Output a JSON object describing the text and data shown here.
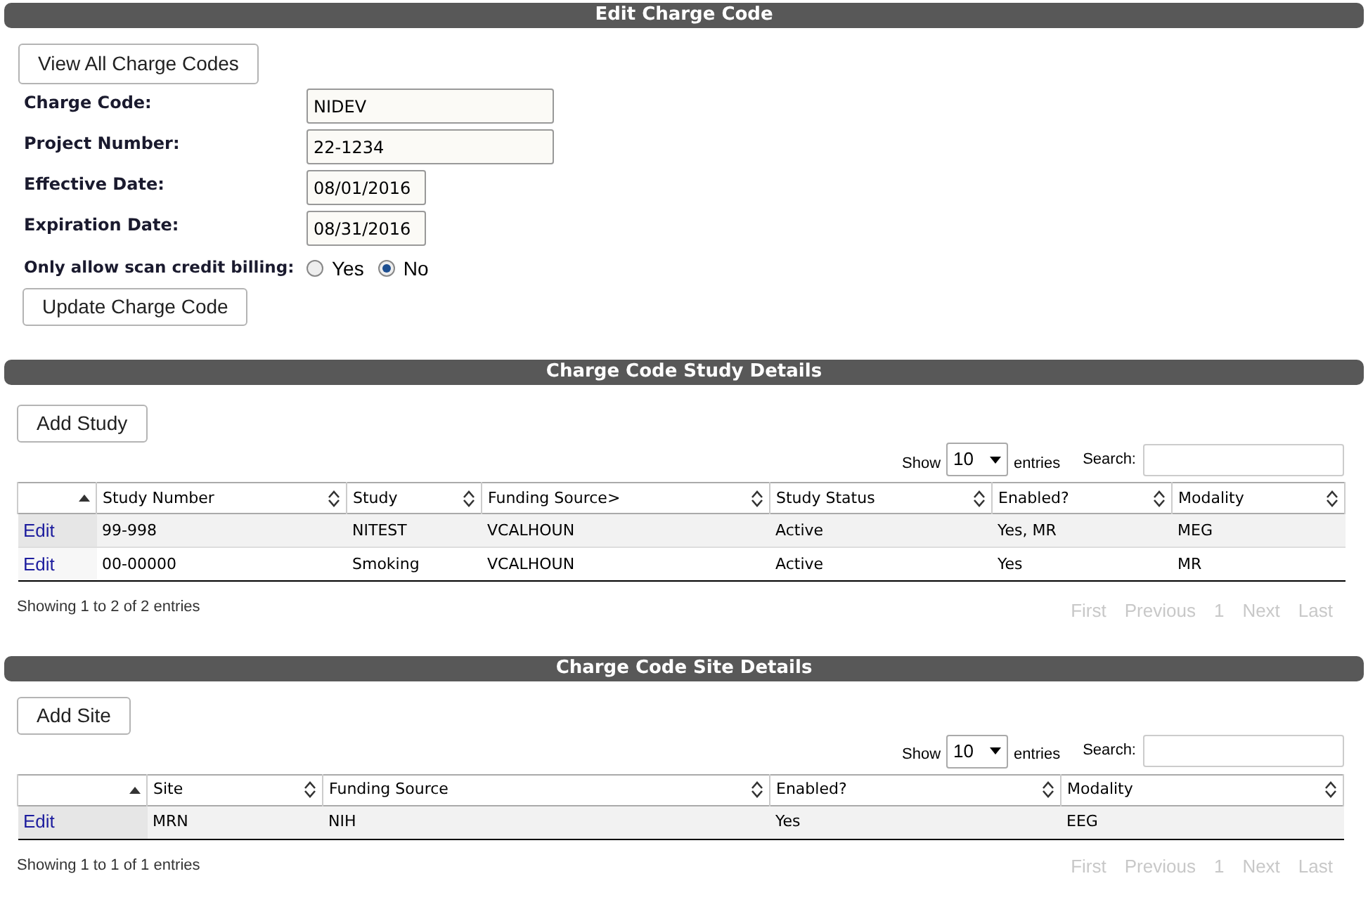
{
  "edit_section": {
    "title": "Edit Charge Code",
    "view_all_button": "View All Charge Codes",
    "fields": [
      {
        "label": "Charge Code:",
        "value": "NIDEV",
        "kind": "wide"
      },
      {
        "label": "Project Number:",
        "value": "22-1234",
        "kind": "wide"
      },
      {
        "label": "Effective Date:",
        "value": "08/01/2016",
        "kind": "date"
      },
      {
        "label": "Expiration Date:",
        "value": "08/31/2016",
        "kind": "date"
      }
    ],
    "billing": {
      "label": "Only allow scan credit billing:",
      "options": [
        {
          "label": "Yes",
          "selected": false
        },
        {
          "label": "No",
          "selected": true
        }
      ]
    },
    "update_button": "Update Charge Code"
  },
  "study_section": {
    "title": "Charge Code Study Details",
    "add_button": "Add Study",
    "show_label": "Show",
    "page_size": "10",
    "entries_label": "entries",
    "search_label": "Search:",
    "columns": [
      {
        "sorted": true
      },
      {
        "label": "Study Number",
        "sorted": false
      },
      {
        "label": "Study",
        "sorted": false
      },
      {
        "label": "Funding Source>",
        "sorted": false
      },
      {
        "label": "Study Status",
        "sorted": false
      },
      {
        "label": "Enabled?",
        "sorted": false
      },
      {
        "label": "Modality",
        "sorted": false
      }
    ],
    "rows": [
      [
        "Edit",
        "99-998",
        "NITEST",
        "VCALHOUN",
        "Active",
        "Yes, MR",
        "MEG"
      ],
      [
        "Edit",
        "00-00000",
        "Smoking",
        "VCALHOUN",
        "Active",
        "Yes",
        "MR"
      ]
    ],
    "info": "Showing 1 to 2 of 2 entries",
    "pagination": [
      {
        "label": "First",
        "disabled": true
      },
      {
        "label": "Previous",
        "disabled": true
      },
      {
        "label": "1",
        "disabled": true
      },
      {
        "label": "Next",
        "disabled": true
      },
      {
        "label": "Last",
        "disabled": true
      }
    ]
  },
  "site_section": {
    "title": "Charge Code Site Details",
    "add_button": "Add Site",
    "show_label": "Show",
    "page_size": "10",
    "entries_label": "entries",
    "search_label": "Search:",
    "columns": [
      {
        "sorted": true
      },
      {
        "label": "Site",
        "sorted": false
      },
      {
        "label": "Funding Source",
        "sorted": false
      },
      {
        "label": "Enabled?",
        "sorted": false
      },
      {
        "label": "Modality",
        "sorted": false
      }
    ],
    "rows": [
      [
        "Edit",
        "MRN",
        "NIH",
        "Yes",
        "EEG"
      ]
    ],
    "info": "Showing 1 to 1 of 1 entries",
    "pagination": [
      {
        "label": "First",
        "disabled": true
      },
      {
        "label": "Previous",
        "disabled": true
      },
      {
        "label": "1",
        "disabled": true
      },
      {
        "label": "Next",
        "disabled": true
      },
      {
        "label": "Last",
        "disabled": true
      }
    ]
  }
}
